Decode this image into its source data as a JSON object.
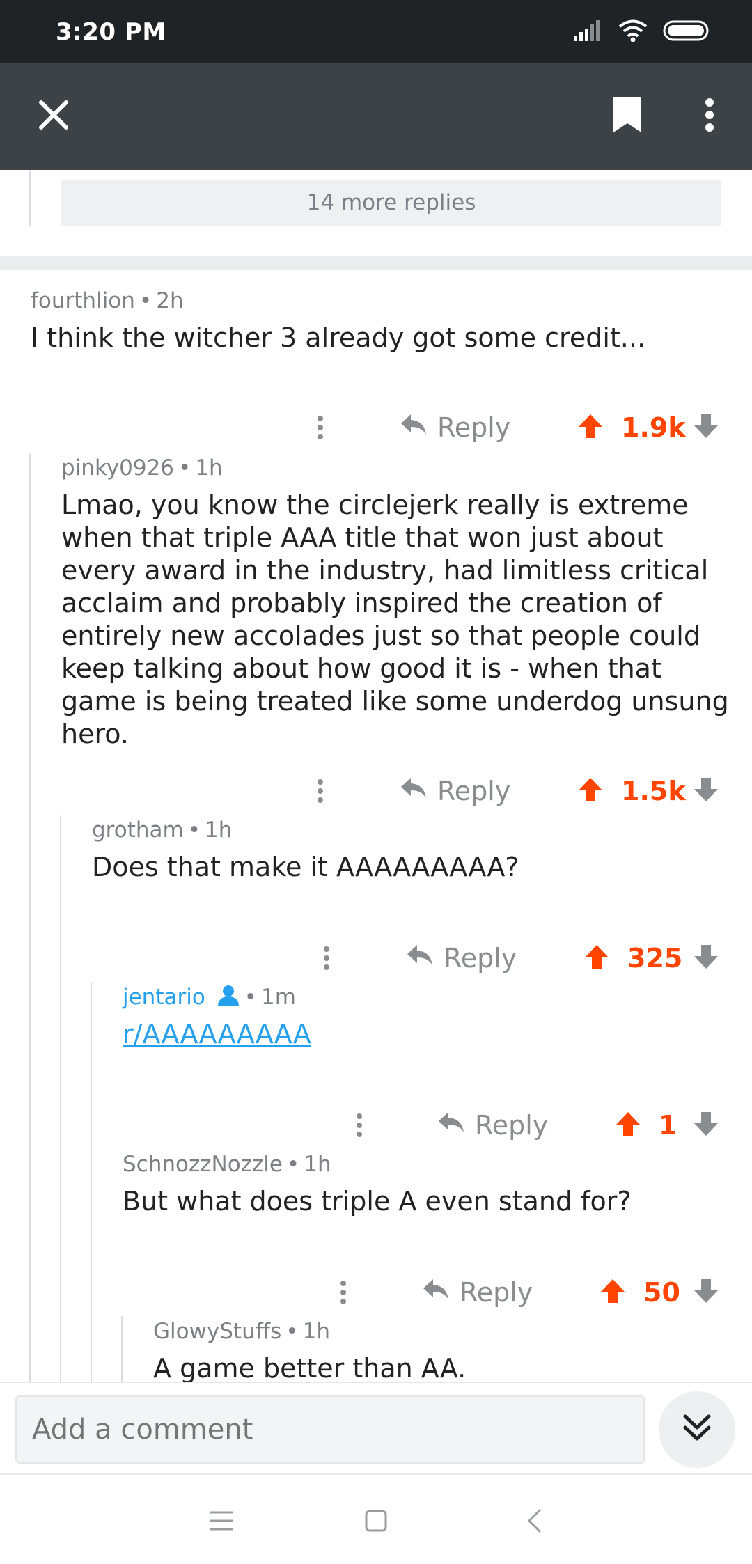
{
  "status_bar": {
    "time": "3:20 PM"
  },
  "app_bar": {
    "close_icon": "close-icon",
    "bookmark_icon": "bookmark-icon",
    "more_icon": "more-vertical-icon"
  },
  "colors": {
    "upvote": "#ff4500",
    "link": "#24a0ed",
    "muted": "#7c8084",
    "app_bar": "#3d4246",
    "status_bar": "#202326"
  },
  "thread": {
    "more_replies": "14 more replies",
    "comments": [
      {
        "user": "fourthlion",
        "age": "2h",
        "body": "I think the witcher 3 already got some credit...",
        "reply_label": "Reply",
        "votes": "1.9k"
      },
      {
        "user": "pinky0926",
        "age": "1h",
        "body": "Lmao, you know the circlejerk really is extreme when that triple AAA title that won just about every award in the industry, had limitless critical acclaim and probably inspired the creation of entirely new accolades just so that people could keep talking about how good it is - when that game is being treated like some underdog unsung hero.",
        "reply_label": "Reply",
        "votes": "1.5k"
      },
      {
        "user": "grotham",
        "age": "1h",
        "body": "Does that make it AAAAAAAAA?",
        "reply_label": "Reply",
        "votes": "325"
      },
      {
        "user": "jentario",
        "age": "1m",
        "body": "r/AAAAAAAAA",
        "reply_label": "Reply",
        "votes": "1",
        "is_op_badge_icon": "user-icon"
      },
      {
        "user": "SchnozzNozzle",
        "age": "1h",
        "body": "But what does triple A even stand for?",
        "reply_label": "Reply",
        "votes": "50"
      },
      {
        "user": "GlowyStuffs",
        "age": "1h",
        "body": "A game better than AA."
      }
    ]
  },
  "composer": {
    "placeholder": "Add a comment"
  }
}
